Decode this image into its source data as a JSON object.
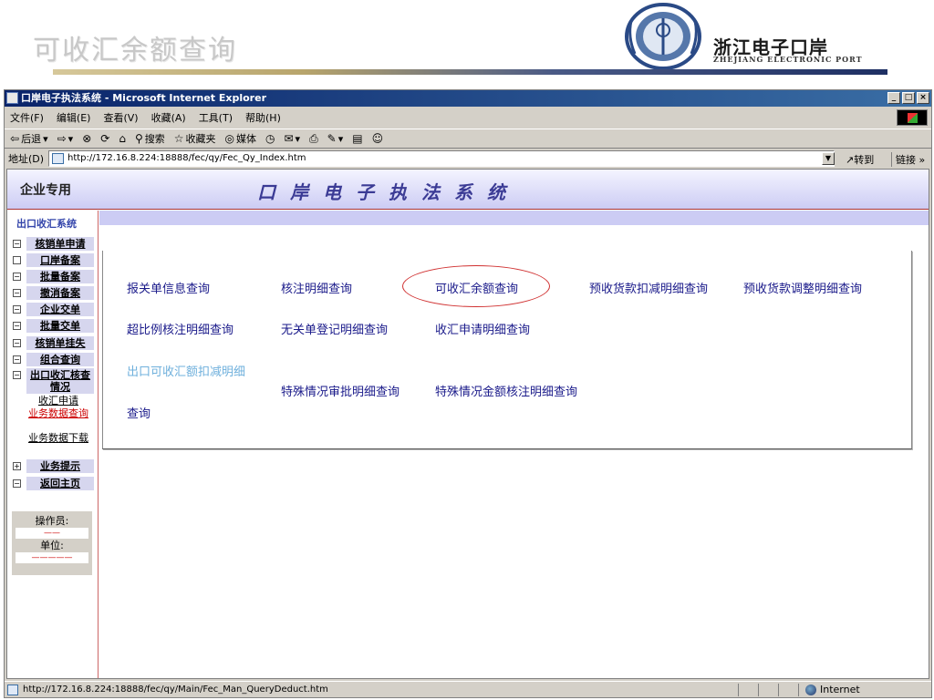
{
  "slide": {
    "title": "可收汇余额查询",
    "brand_cn": "浙江电子口岸",
    "brand_en": "ZHEJIANG ELECTRONIC PORT"
  },
  "window": {
    "title": "口岸电子执法系统 - Microsoft Internet Explorer",
    "controls": {
      "minimize": "_",
      "maximize": "□",
      "close": "×"
    }
  },
  "menu": [
    "文件(F)",
    "编辑(E)",
    "查看(V)",
    "收藏(A)",
    "工具(T)",
    "帮助(H)"
  ],
  "toolbar": {
    "back": "后退",
    "search": "搜索",
    "favorites": "收藏夹",
    "media": "媒体"
  },
  "address": {
    "label": "地址(D)",
    "url": "http://172.16.8.224:18888/fec/qy/Fec_Qy_Index.htm",
    "go": "转到",
    "links": "链接 »"
  },
  "page": {
    "enterprise": "企业专用",
    "system_name": "口岸电子执法系统"
  },
  "sidebar": {
    "title": "出口收汇系统",
    "items": [
      {
        "box": "−",
        "label": "核销单申请"
      },
      {
        "box": "",
        "label": "口岸备案"
      },
      {
        "box": "−",
        "label": "批量备案"
      },
      {
        "box": "−",
        "label": "撤消备案"
      },
      {
        "box": "−",
        "label": "企业交单"
      },
      {
        "box": "−",
        "label": "批量交单"
      },
      {
        "box": "−",
        "label": "核销单挂失"
      },
      {
        "box": "−",
        "label": "组合查询"
      },
      {
        "box": "−",
        "label": "出口收汇核查情况"
      }
    ],
    "subitems": [
      {
        "label": "收汇申请"
      },
      {
        "label": "业务数据查询"
      },
      {
        "label": "业务数据下载"
      }
    ],
    "items2": [
      {
        "box": "+",
        "label": "业务提示"
      },
      {
        "box": "−",
        "label": "返回主页"
      }
    ],
    "operator_label": "操作员:",
    "operator_value": "——",
    "unit_label": "单位:",
    "unit_value": "—————"
  },
  "queries": {
    "row1": [
      "报关单信息查询",
      "核注明细查询",
      "可收汇余额查询",
      "预收货款扣减明细查询",
      "预收货款调整明细查询"
    ],
    "row2": [
      "超比例核注明细查询",
      "无关单登记明细查询",
      "收汇申请明细查询"
    ],
    "row3_col1_line1": "出口可收汇额扣减明细",
    "row3_col1_line2": "查询",
    "row3": [
      "特殊情况审批明细查询",
      "特殊情况金额核注明细查询"
    ]
  },
  "status": {
    "url": "http://172.16.8.224:18888/fec/qy/Main/Fec_Man_QueryDeduct.htm",
    "zone": "Internet"
  }
}
